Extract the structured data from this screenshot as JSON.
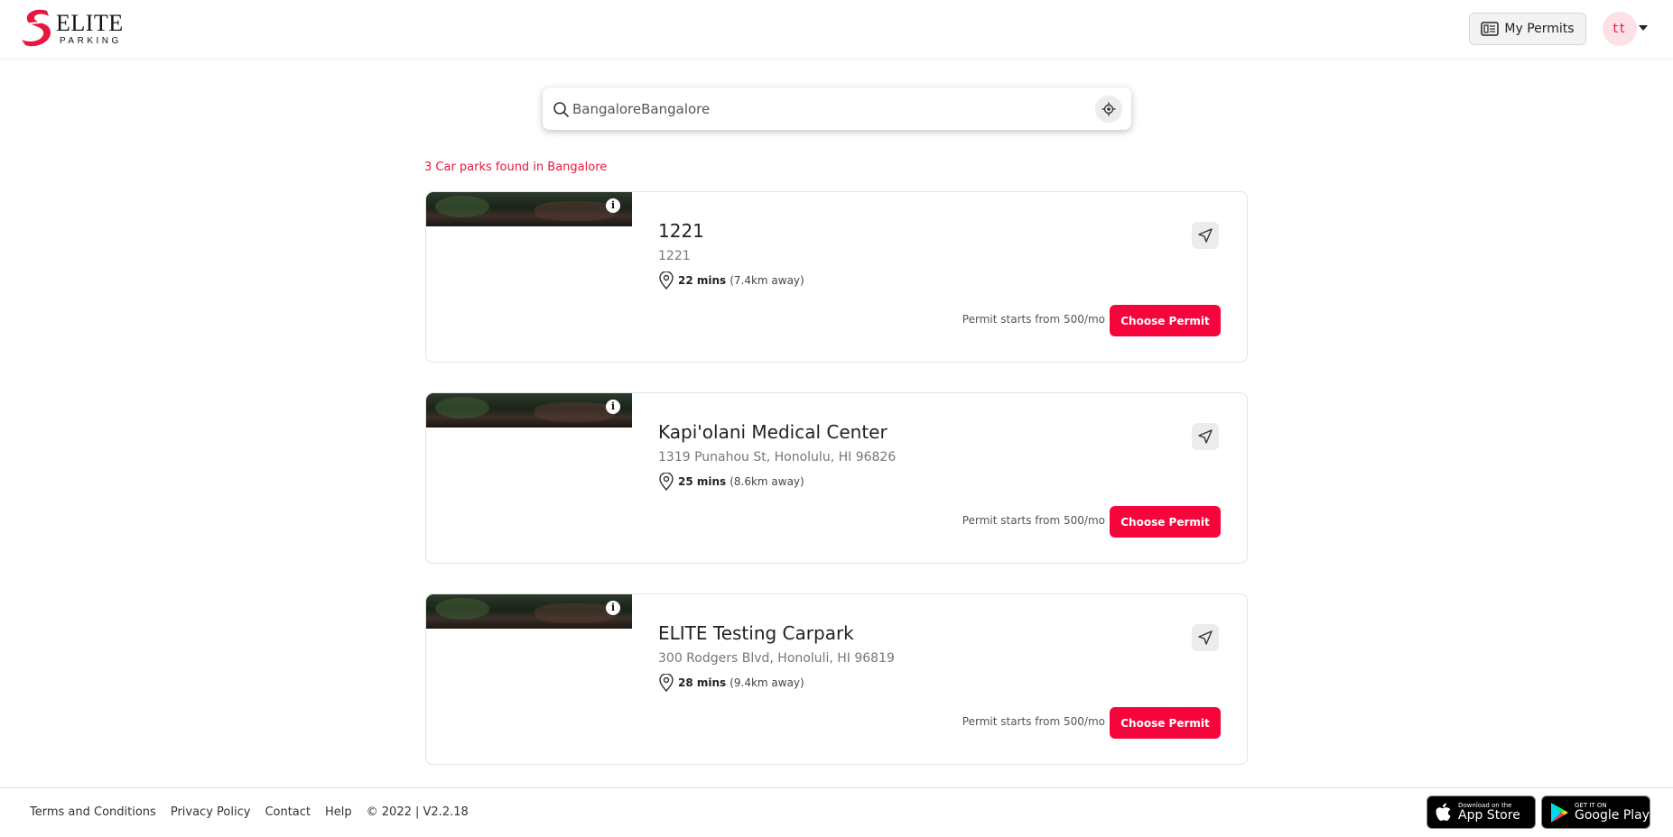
{
  "brand": {
    "logo_top": "ELITE",
    "logo_bottom": "PARKING",
    "accent": "#f5053c"
  },
  "header": {
    "my_permits_label": "My Permits",
    "avatar_initials": "tt"
  },
  "search": {
    "value": "BangaloreBangalore"
  },
  "results": {
    "count_text": "3 Car parks found in Bangalore",
    "items": [
      {
        "title": "1221",
        "address": "1221",
        "mins": "22 mins",
        "distance": "(7.4km away)",
        "price_text": "Permit starts from 500/mo",
        "cta": "Choose Permit"
      },
      {
        "title": "Kapi'olani Medical Center",
        "address": "1319 Punahou St, Honolulu, HI 96826",
        "mins": "25 mins",
        "distance": "(8.6km away)",
        "price_text": "Permit starts from 500/mo",
        "cta": "Choose Permit"
      },
      {
        "title": "ELITE Testing Carpark",
        "address": "300 Rodgers Blvd, Honoluli, HI 96819",
        "mins": "28 mins",
        "distance": "(9.4km away)",
        "price_text": "Permit starts from 500/mo",
        "cta": "Choose Permit"
      }
    ]
  },
  "footer": {
    "links": [
      "Terms and Conditions",
      "Privacy Policy",
      "Contact",
      "Help"
    ],
    "copyright": "© 2022 | V2.2.18",
    "app_store": {
      "small": "Download on the",
      "big": "App Store"
    },
    "google_play": {
      "small": "GET IT ON",
      "big": "Google Play"
    }
  }
}
